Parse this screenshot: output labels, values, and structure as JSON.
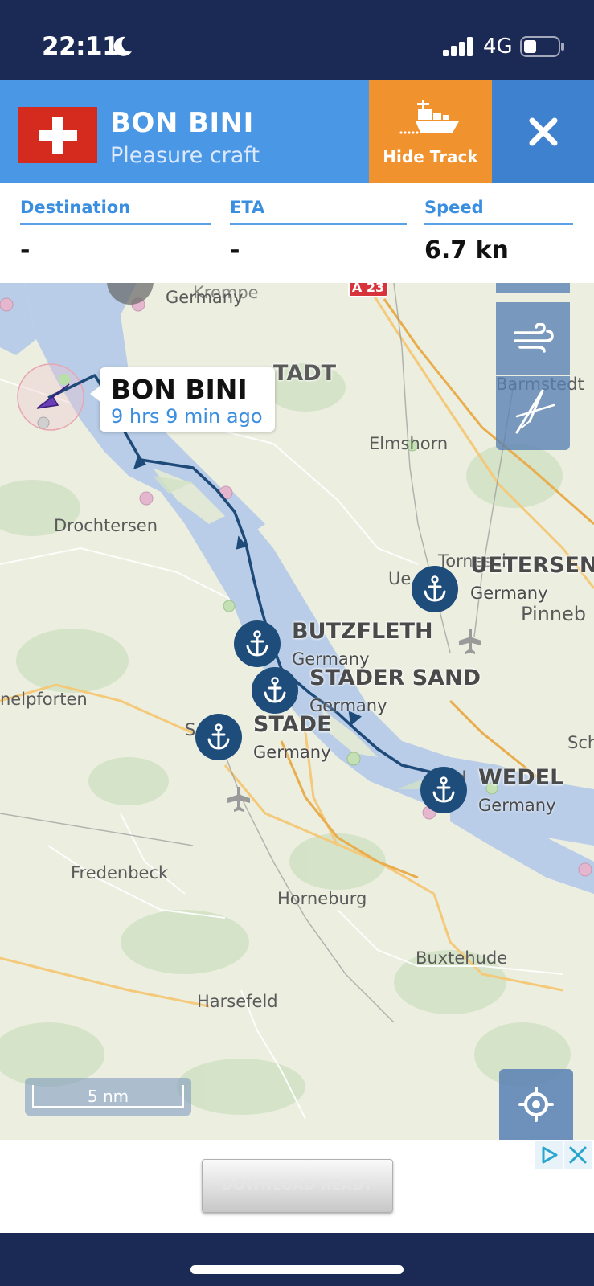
{
  "status_bar": {
    "time": "22:11",
    "network": "4G",
    "icons": [
      "moon-icon",
      "signal-icon",
      "battery-icon"
    ]
  },
  "vessel": {
    "name": "BON BINI",
    "type": "Pleasure craft",
    "flag": "switzerland-flag",
    "hide_track_label": "Hide Track"
  },
  "info": {
    "destination_label": "Destination",
    "destination_value": "-",
    "eta_label": "ETA",
    "eta_value": "-",
    "speed_label": "Speed",
    "speed_value": "6.7 kn"
  },
  "map": {
    "places": {
      "krempe": "Krempe",
      "krempe_country": "Germany",
      "glueckstadt": "TADT",
      "barmstedt": "Barmstedt",
      "elmshorn": "Elmshorn",
      "drochtersen": "Drochtersen",
      "tornesch": "Tornesch",
      "uetersen_small": "Ue",
      "pinneberg": "Pinneb",
      "himmelpforten": "nelpforten",
      "stade_small": "S",
      "wedel_small": "ed",
      "schenefeld": "Sch",
      "fredenbeck": "Fredenbeck",
      "horneburg": "Horneburg",
      "buxtehude": "Buxtehude",
      "harsefeld": "Harsefeld"
    },
    "road_badge": "A 23",
    "ports": [
      {
        "name": "UETERSEN",
        "country": "Germany"
      },
      {
        "name": "BUTZFLETH",
        "country": "Germany"
      },
      {
        "name": "STADER SAND",
        "country": "Germany"
      },
      {
        "name": "STADE",
        "country": "Germany"
      },
      {
        "name": "WEDEL",
        "country": "Germany"
      }
    ],
    "tooltip": {
      "name": "BON BINI",
      "time_ago": "9 hrs 9 min ago"
    },
    "scale_label": "5 nm",
    "side_buttons": [
      "layers-button",
      "wind-icon",
      "measure-compass-icon"
    ]
  },
  "ad": {
    "button_text": "DOWNLOAD READY"
  },
  "colors": {
    "status_bar": "#1b2a55",
    "header": "#4a97e6",
    "hide_track": "#f0922e",
    "close": "#3e82cf",
    "accent_text": "#3a8ee0",
    "port_marker": "#1e4d7b",
    "river": "#b9cde8",
    "track": "#1d4a78"
  }
}
